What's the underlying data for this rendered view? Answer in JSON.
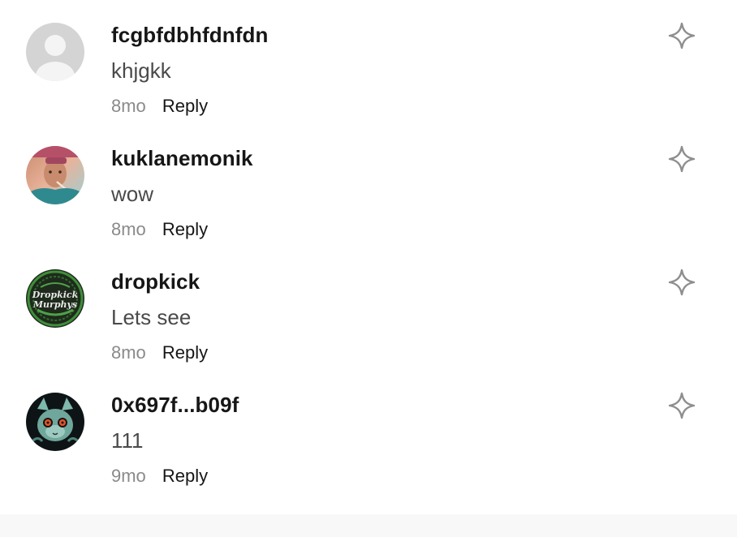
{
  "comments": [
    {
      "username": "fcgbfdbhfdnfdn",
      "text": "khjgkk",
      "time": "8mo",
      "reply_label": "Reply",
      "avatar_icon": "default-user-avatar"
    },
    {
      "username": "kuklanemonik",
      "text": "wow",
      "time": "8mo",
      "reply_label": "Reply",
      "avatar_icon": "photo-avatar"
    },
    {
      "username": "dropkick",
      "text": "Lets see",
      "time": "8mo",
      "reply_label": "Reply",
      "avatar_icon": "dropkick-murphys-logo-avatar",
      "avatar_logo_lines": [
        "Dropkick",
        "Murphys"
      ]
    },
    {
      "username": "0x697f...b09f",
      "text": "111",
      "time": "9mo",
      "reply_label": "Reply",
      "avatar_icon": "creature-avatar"
    }
  ],
  "icons": {
    "like": "sparkle-star-icon"
  },
  "colors": {
    "username": "#161616",
    "body": "#4a4a4a",
    "time": "#8a8a8a",
    "star": "#8e8e8e"
  }
}
